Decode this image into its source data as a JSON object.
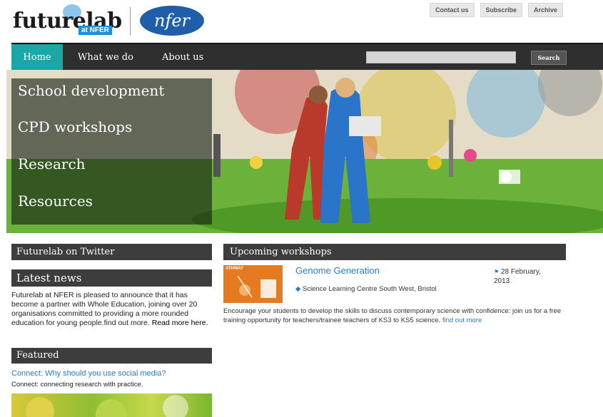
{
  "header": {
    "logo_text": "futurelab",
    "logo_sub": "at NFER",
    "partner_logo": "nfer",
    "top_links": [
      "Contact us",
      "Subscribe",
      "Archive"
    ]
  },
  "nav": {
    "items": [
      "Home",
      "What we do",
      "About us"
    ],
    "active": "Home",
    "search_value": "",
    "search_button": "Search"
  },
  "hero": {
    "menu": [
      "School development",
      "CPD workshops",
      "Research",
      "Resources"
    ]
  },
  "sidebar": {
    "twitter_heading": "Futurelab on Twitter",
    "news_heading": "Latest news",
    "news_text": "Futurelab at NFER is pleased to announce that it has become a partner with Whole Education, joining over 20 organisations committed to providing a more rounded education for young people.find out more.",
    "news_more": "Read more here.",
    "featured_heading": "Featured",
    "featured_link": "Connect: Why should you use social media?",
    "featured_sub": "Connect: connecting research with practice."
  },
  "workshops": {
    "heading": "Upcoming workshops",
    "items": [
      {
        "thumb_label": "ATHWAY",
        "title": "Genome Generation",
        "date": "28 February, 2013",
        "location": "Science Learning Centre South West, Bristol",
        "description": "Encourage your students to develop the skills to discuss contemporary science with confidence: join us for a free training opportunity for teachers/trainee teachers of KS3 to KS5 science.",
        "more": "find out more"
      }
    ]
  },
  "colors": {
    "accent": "#1aa7a5",
    "link": "#2a7cc7",
    "nav_bg": "#2f2f2f",
    "heading_bg": "#3d3d3d"
  }
}
